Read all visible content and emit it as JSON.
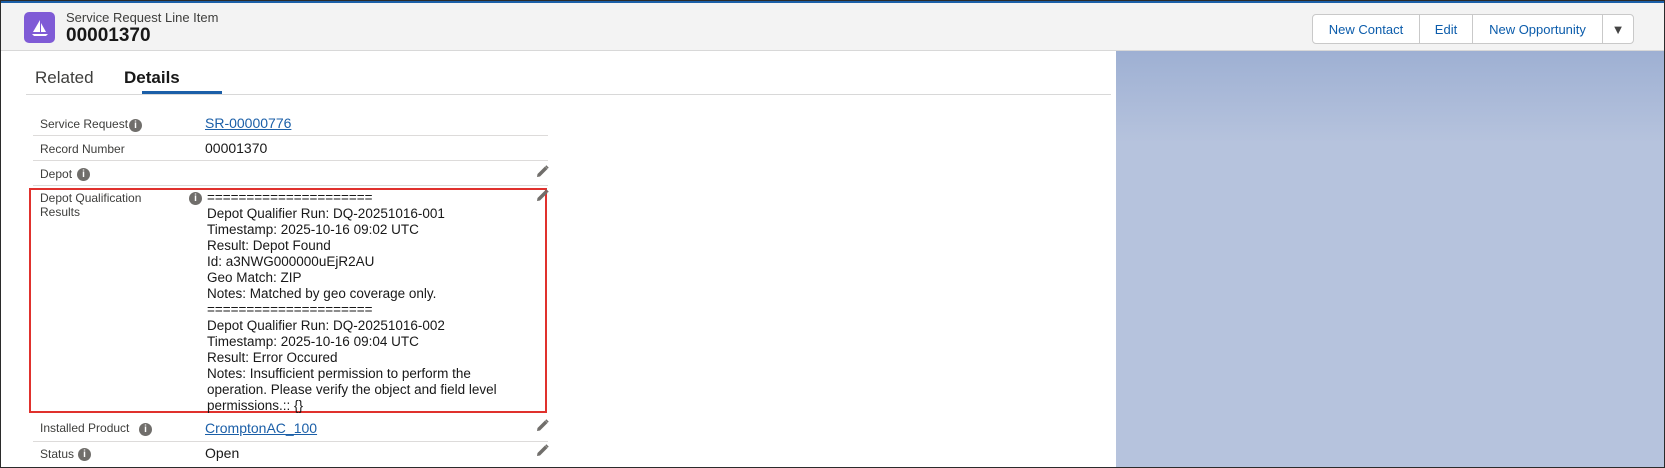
{
  "header": {
    "object_type": "Service Request Line Item",
    "record_name": "00001370",
    "icon": "sailboat-icon",
    "buttons": {
      "new_contact": "New Contact",
      "edit": "Edit",
      "new_opportunity": "New Opportunity",
      "more": "▼"
    }
  },
  "tabs": {
    "related": "Related",
    "details": "Details",
    "active": "Details"
  },
  "fields": {
    "service_request": {
      "label": "Service Request",
      "value": "SR-00000776"
    },
    "record_number": {
      "label": "Record Number",
      "value": "00001370"
    },
    "depot": {
      "label": "Depot",
      "value": ""
    },
    "depot_qualification_results": {
      "label": "Depot Qualification Results",
      "value": "=====================\nDepot Qualifier Run: DQ-20251016-001\nTimestamp: 2025-10-16 09:02 UTC\nResult: Depot Found\nId: a3NWG000000uEjR2AU\nGeo Match: ZIP\nNotes: Matched by geo coverage only.\n=====================\nDepot Qualifier Run: DQ-20251016-002\nTimestamp: 2025-10-16 09:04 UTC\nResult: Error Occured\nNotes: Insufficient permission to perform the operation. Please verify the object and field level permissions.:: {}"
    },
    "installed_product": {
      "label": "Installed Product",
      "value": "CromptonAC_100"
    },
    "status": {
      "label": "Status",
      "value": "Open"
    }
  },
  "colors": {
    "brand": "#1b5fa8",
    "icon_bg": "#7f5bd6",
    "highlight": "#e0312d"
  }
}
